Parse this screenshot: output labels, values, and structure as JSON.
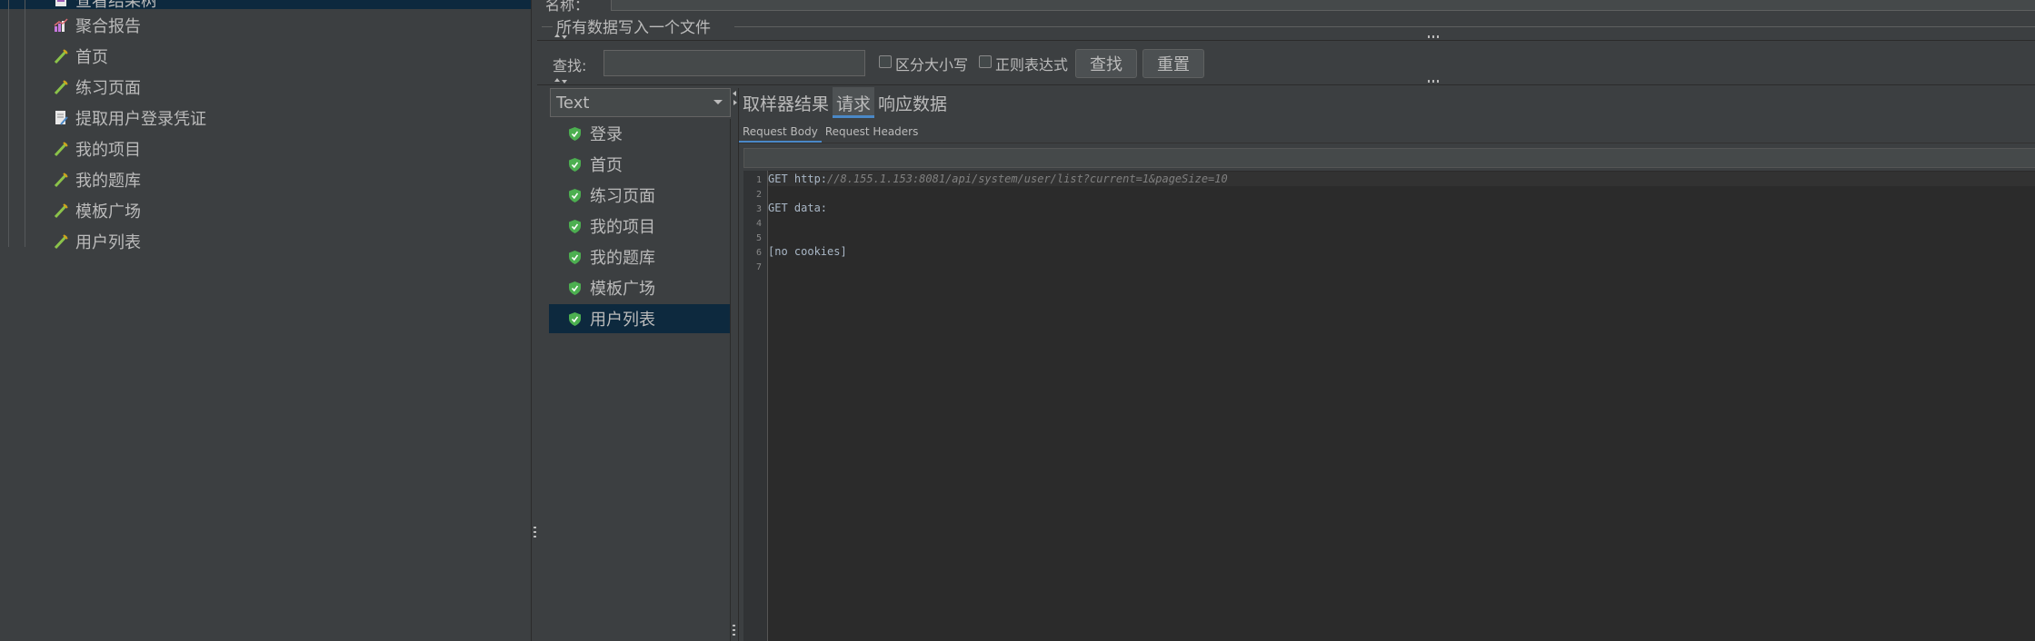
{
  "tree": {
    "items": [
      {
        "label": "查看结果树",
        "icon": "report-icon"
      },
      {
        "label": "聚合报告",
        "icon": "chart-icon"
      },
      {
        "label": "首页",
        "icon": "sampler-icon"
      },
      {
        "label": "练习页面",
        "icon": "sampler-icon"
      },
      {
        "label": "提取用户登录凭证",
        "icon": "script-icon"
      },
      {
        "label": "我的项目",
        "icon": "sampler-icon"
      },
      {
        "label": "我的题库",
        "icon": "sampler-icon"
      },
      {
        "label": "模板广场",
        "icon": "sampler-icon"
      },
      {
        "label": "用户列表",
        "icon": "sampler-icon"
      }
    ]
  },
  "header": {
    "clipped_label": "名称：",
    "write_all_label": "所有数据写入一个文件"
  },
  "search": {
    "label": "查找:",
    "value": "",
    "case_label": "区分大小写",
    "regex_label": "正则表达式",
    "find_button": "查找",
    "reset_button": "重置"
  },
  "renderer": {
    "selected": "Text"
  },
  "results": [
    {
      "label": "登录",
      "status": "success"
    },
    {
      "label": "首页",
      "status": "success"
    },
    {
      "label": "练习页面",
      "status": "success"
    },
    {
      "label": "我的项目",
      "status": "success"
    },
    {
      "label": "我的题库",
      "status": "success"
    },
    {
      "label": "模板广场",
      "status": "success"
    },
    {
      "label": "用户列表",
      "status": "success",
      "selected": true
    }
  ],
  "tabs": [
    {
      "label": "取样器结果",
      "active": false
    },
    {
      "label": "请求",
      "active": true
    },
    {
      "label": "响应数据",
      "active": false
    }
  ],
  "subtabs": [
    {
      "label": "Request Body",
      "active": true
    },
    {
      "label": "Request Headers",
      "active": false
    }
  ],
  "editor": {
    "lines": [
      {
        "n": "1",
        "prefix": "GET http:",
        "url": "//8.155.1.153:8081/api/system/user/list?current=1&pageSize=10"
      },
      {
        "n": "2",
        "prefix": "",
        "url": ""
      },
      {
        "n": "3",
        "prefix": "GET data:",
        "url": ""
      },
      {
        "n": "4",
        "prefix": "",
        "url": ""
      },
      {
        "n": "5",
        "prefix": "",
        "url": ""
      },
      {
        "n": "6",
        "prefix": "[no cookies]",
        "url": ""
      },
      {
        "n": "7",
        "prefix": "",
        "url": ""
      }
    ]
  },
  "colors": {
    "background": "#3c3f41",
    "selection": "#0d293e",
    "editor_bg": "#2b2b2b",
    "success_icon": "#4caf50",
    "accent": "#4a88c7"
  }
}
